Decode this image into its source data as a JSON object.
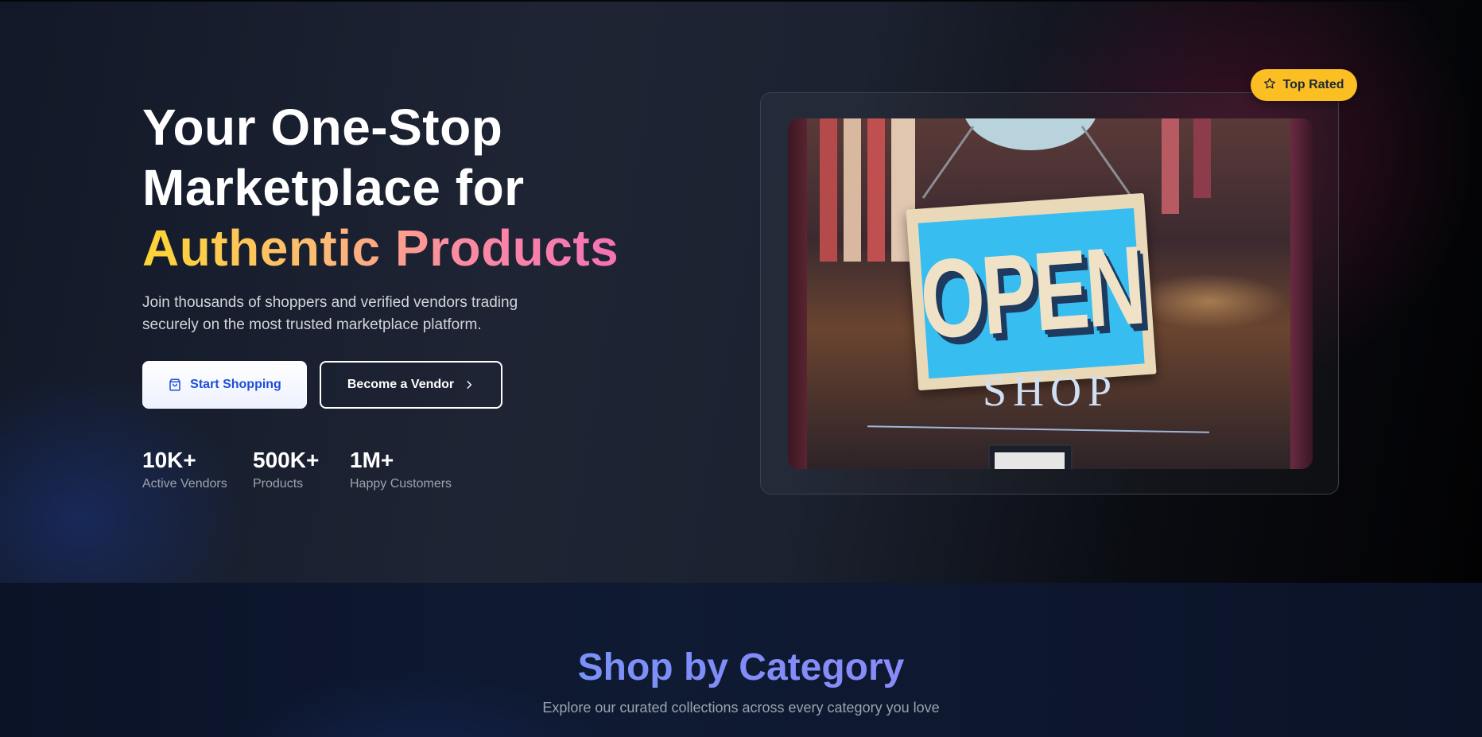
{
  "hero": {
    "headline_line1": "Your One-Stop",
    "headline_line2": "Marketplace for",
    "headline_highlight": "Authentic Products",
    "subtitle": "Join thousands of shoppers and verified vendors trading securely on the most trusted marketplace platform.",
    "primary_button": {
      "label": "Start Shopping",
      "icon": "shopping-bag-icon"
    },
    "secondary_button": {
      "label": "Become a Vendor",
      "icon": "chevron-right-icon"
    },
    "stats": [
      {
        "value": "10K+",
        "label": "Active Vendors"
      },
      {
        "value": "500K+",
        "label": "Products"
      },
      {
        "value": "1M+",
        "label": "Happy Customers"
      }
    ],
    "badge": {
      "label": "Top Rated",
      "icon": "star-icon"
    },
    "image": {
      "sign_text": "OPEN",
      "sign_sub": "SHOP"
    }
  },
  "categories": {
    "title": "Shop by Category",
    "subtitle": "Explore our curated collections across every category you love"
  },
  "colors": {
    "highlight_gradient": [
      "#fcd535",
      "#fdba74",
      "#f472b6"
    ],
    "primary_button_text": "#1d4ed8",
    "badge_bg": "#fbbf24",
    "category_title_gradient": [
      "#60a5fa",
      "#818cf8",
      "#a78bfa"
    ]
  }
}
